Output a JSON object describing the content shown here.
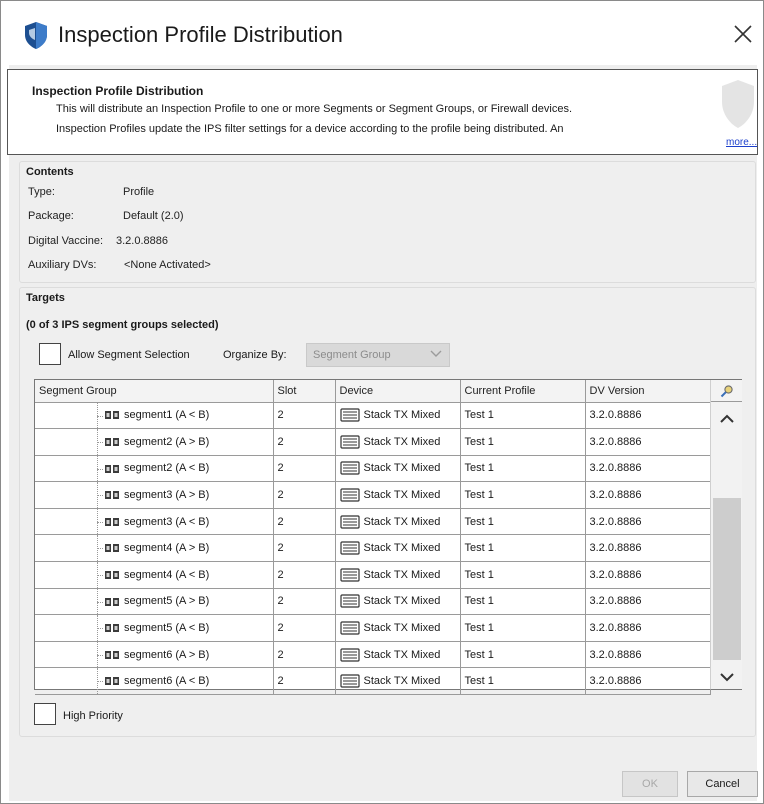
{
  "window": {
    "title": "Inspection Profile Distribution"
  },
  "banner": {
    "title": "Inspection Profile Distribution",
    "line1": "This will distribute an Inspection Profile to one or more Segments or Segment Groups, or Firewall devices.",
    "line2": "Inspection Profiles update the IPS filter settings for a device according to the profile being distributed. An",
    "more_label": "more..."
  },
  "contents": {
    "title": "Contents",
    "fields": [
      {
        "label": "Type:",
        "value": "Profile"
      },
      {
        "label": "Package:",
        "value": "Default (2.0)"
      },
      {
        "label": "Digital Vaccine:",
        "value": "3.2.0.8886"
      },
      {
        "label": "Auxiliary DVs:",
        "value": "<None Activated>"
      }
    ]
  },
  "targets": {
    "title": "Targets",
    "selection_summary": "(0 of 3 IPS segment groups selected)",
    "allow_segment_selection_label": "Allow Segment Selection",
    "allow_segment_selection_checked": false,
    "organize_by_label": "Organize By:",
    "organize_by_value": "Segment Group",
    "table": {
      "columns": [
        "Segment Group",
        "Slot",
        "Device",
        "Current Profile",
        "DV Version"
      ],
      "rows": [
        {
          "segment": "segment1 (A < B)",
          "slot": "2",
          "device": "Stack TX Mixed",
          "profile": "Test 1",
          "dv": "3.2.0.8886"
        },
        {
          "segment": "segment2 (A > B)",
          "slot": "2",
          "device": "Stack TX Mixed",
          "profile": "Test 1",
          "dv": "3.2.0.8886"
        },
        {
          "segment": "segment2 (A < B)",
          "slot": "2",
          "device": "Stack TX Mixed",
          "profile": "Test 1",
          "dv": "3.2.0.8886"
        },
        {
          "segment": "segment3 (A > B)",
          "slot": "2",
          "device": "Stack TX Mixed",
          "profile": "Test 1",
          "dv": "3.2.0.8886"
        },
        {
          "segment": "segment3 (A < B)",
          "slot": "2",
          "device": "Stack TX Mixed",
          "profile": "Test 1",
          "dv": "3.2.0.8886"
        },
        {
          "segment": "segment4 (A > B)",
          "slot": "2",
          "device": "Stack TX Mixed",
          "profile": "Test 1",
          "dv": "3.2.0.8886"
        },
        {
          "segment": "segment4 (A < B)",
          "slot": "2",
          "device": "Stack TX Mixed",
          "profile": "Test 1",
          "dv": "3.2.0.8886"
        },
        {
          "segment": "segment5 (A > B)",
          "slot": "2",
          "device": "Stack TX Mixed",
          "profile": "Test 1",
          "dv": "3.2.0.8886"
        },
        {
          "segment": "segment5 (A < B)",
          "slot": "2",
          "device": "Stack TX Mixed",
          "profile": "Test 1",
          "dv": "3.2.0.8886"
        },
        {
          "segment": "segment6 (A > B)",
          "slot": "2",
          "device": "Stack TX Mixed",
          "profile": "Test 1",
          "dv": "3.2.0.8886"
        },
        {
          "segment": "segment6 (A < B)",
          "slot": "2",
          "device": "Stack TX Mixed",
          "profile": "Test 1",
          "dv": "3.2.0.8886"
        }
      ]
    },
    "high_priority_label": "High Priority",
    "high_priority_checked": false
  },
  "footer": {
    "ok_label": "OK",
    "ok_enabled": false,
    "cancel_label": "Cancel"
  },
  "icons": {
    "app": "shield-icon",
    "close": "close-icon",
    "segment": "segment-icon",
    "device": "device-icon",
    "search": "search-icon",
    "scroll_up": "chevron-up-icon",
    "scroll_down": "chevron-down-icon",
    "dropdown": "chevron-down-icon"
  },
  "colors": {
    "link": "#1c3fcc",
    "dialog_background": "#eeeeee",
    "disabled_text": "#a8a8a8"
  }
}
